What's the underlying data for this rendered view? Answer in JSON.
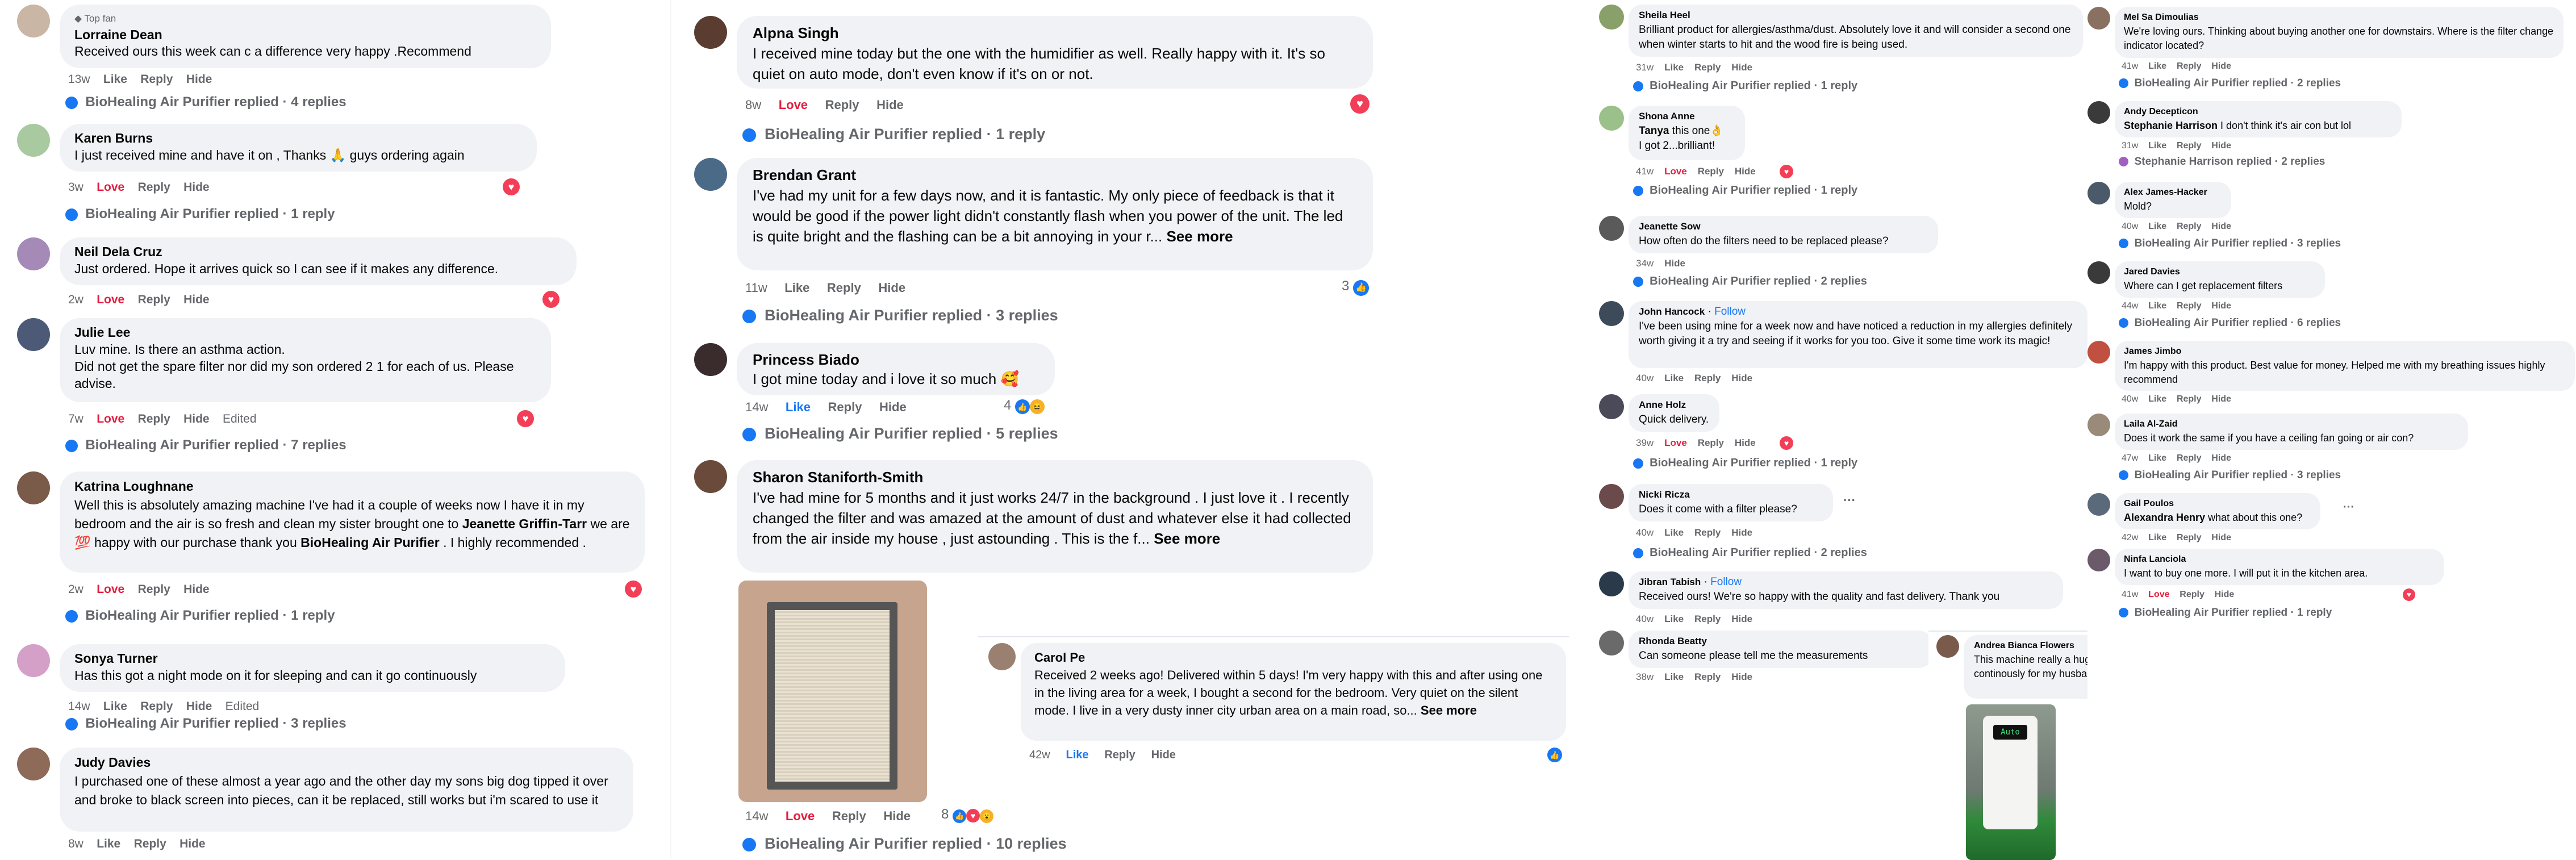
{
  "panel1": {
    "comments": [
      {
        "badge": "Top fan",
        "name": "Lorraine Dean",
        "text": "Received ours this week can c a difference very happy .Recommend",
        "time": "13w",
        "like": "Like",
        "reply": "Reply",
        "hide": "Hide",
        "replies": "BioHealing Air Purifier replied · 4 replies"
      },
      {
        "name": "Karen Burns",
        "text": "I just received mine and have it on , Thanks 🙏 guys ordering again",
        "time": "3w",
        "love": "Love",
        "reply": "Reply",
        "hide": "Hide",
        "replies": "BioHealing Air Purifier replied · 1 reply"
      },
      {
        "name": "Neil Dela Cruz",
        "text": "Just ordered. Hope it arrives quick so I can see if it makes any difference.",
        "time": "2w",
        "love": "Love",
        "reply": "Reply",
        "hide": "Hide"
      },
      {
        "name": "Julie Lee",
        "text": "Luv mine. Is there an asthma action.",
        "text2": "Did not get the spare filter nor did my son ordered 2 1 for each of us. Please advise.",
        "time": "7w",
        "love": "Love",
        "reply": "Reply",
        "hide": "Hide",
        "edited": "Edited",
        "replies": "BioHealing Air Purifier replied · 7 replies"
      },
      {
        "name": "Katrina Loughnane",
        "text_a": "Well this is absolutely amazing machine I've had it a couple of weeks now I have it in my bedroom and the air is so fresh and clean my sister brought one to ",
        "mention1": "Jeanette Griffin-Tarr",
        "text_b": " we are 💯 happy with our purchase thank you ",
        "mention2": "BioHealing Air Purifier",
        "text_c": " . I highly recommended .",
        "time": "2w",
        "love": "Love",
        "reply": "Reply",
        "hide": "Hide",
        "replies": "BioHealing Air Purifier replied · 1 reply"
      },
      {
        "name": "Sonya Turner",
        "text": "Has this got a night mode on it for sleeping and can it go continuously",
        "time": "14w",
        "like": "Like",
        "reply": "Reply",
        "hide": "Hide",
        "edited": "Edited",
        "replies": "BioHealing Air Purifier replied · 3 replies"
      },
      {
        "name": "Judy Davies",
        "text": "I purchased one of these almost a year ago and the other day my sons big dog tipped it over and broke to black screen into pieces, can it be replaced, still works but i'm scared to use it",
        "time": "8w",
        "like": "Like",
        "reply": "Reply",
        "hide": "Hide"
      }
    ]
  },
  "panel2": {
    "comments": [
      {
        "name": "Alpna Singh",
        "text": "I received mine today but the one with the humidifier as well. Really happy with it. It's so quiet on auto mode, don't even know if it's on or not.",
        "time": "8w",
        "love": "Love",
        "reply": "Reply",
        "hide": "Hide",
        "replies": "BioHealing Air Purifier replied · 1 reply"
      },
      {
        "name": "Brendan Grant",
        "text": "I've had my unit for a few days now, and it is fantastic. My only piece of feedback is that it would be good if the power light didn't constantly flash when you power of the unit. The led is quite bright and the flashing can be a bit annoying in your r...",
        "see_more": "See more",
        "time": "11w",
        "like": "Like",
        "reply": "Reply",
        "hide": "Hide",
        "reaction_count": "3",
        "replies": "BioHealing Air Purifier replied · 3 replies"
      },
      {
        "name": "Princess Biado",
        "text": "I got mine today and i love it so much 🥰",
        "time": "14w",
        "like": "Like",
        "reply": "Reply",
        "hide": "Hide",
        "reaction_count": "4",
        "replies": "BioHealing Air Purifier replied · 5 replies"
      },
      {
        "name": "Sharon Staniforth-Smith",
        "text": "I've had mine for 5 months and it just works 24/7 in the background . I just love it . I recently changed the filter and was amazed at the amount of dust and whatever else it had collected from the air inside my house , just astounding . This is the f...",
        "see_more": "See more",
        "time": "14w",
        "love": "Love",
        "reply": "Reply",
        "hide": "Hide",
        "reaction_count": "8",
        "replies": "BioHealing Air Purifier replied · 10 replies"
      },
      {
        "name": "Carol Pe",
        "text": "Received 2 weeks ago! Delivered within 5 days! I'm very happy with this and after using one in the living area for a week, I bought a second for the bedroom. Very quiet on the silent mode. I live in a very dusty inner city urban area on a main road, so...",
        "see_more": "See more",
        "time": "42w",
        "like": "Like",
        "reply": "Reply",
        "hide": "Hide"
      }
    ]
  },
  "panel3": {
    "comments": [
      {
        "name": "Sheila Heel",
        "text": "Brilliant product for allergies/asthma/dust. Absolutely love it and will consider a second one when winter starts to hit and the wood fire is being used.",
        "time": "31w",
        "like": "Like",
        "reply": "Reply",
        "hide": "Hide",
        "replies": "BioHealing Air Purifier replied · 1 reply"
      },
      {
        "name": "Shona Anne",
        "mention": "Tanya",
        "text": " this one👌",
        "text2": "I got 2...brilliant!",
        "time": "41w",
        "love": "Love",
        "reply": "Reply",
        "hide": "Hide",
        "replies": "BioHealing Air Purifier replied · 1 reply"
      },
      {
        "name": "Jeanette Sow",
        "text": "How often do the filters need to be replaced please?",
        "time": "34w",
        "hide": "Hide",
        "replies": "BioHealing Air Purifier replied · 2 replies"
      },
      {
        "name": "John Hancock",
        "follow": "Follow",
        "text": "I've been using mine for a week now and have noticed a reduction in my allergies definitely worth giving it a try and seeing if it works for you too. Give it some time work its magic!",
        "time": "40w",
        "like": "Like",
        "reply": "Reply",
        "hide": "Hide"
      },
      {
        "name": "Anne Holz",
        "text": "Quick delivery.",
        "time": "39w",
        "love": "Love",
        "reply": "Reply",
        "hide": "Hide",
        "replies": "BioHealing Air Purifier replied · 1 reply"
      },
      {
        "name": "Nicki Ricza",
        "text": "Does it come with a filter please?",
        "time": "40w",
        "like": "Like",
        "reply": "Reply",
        "hide": "Hide",
        "replies": "BioHealing Air Purifier replied · 2 replies"
      },
      {
        "name": "Jibran Tabish",
        "follow": "Follow",
        "text": "Received ours! We're so happy with the quality and fast delivery. Thank you",
        "time": "40w",
        "like": "Like",
        "reply": "Reply",
        "hide": "Hide"
      },
      {
        "name": "Rhonda Beatty",
        "text": "Can someone please tell me the measurements",
        "time": "38w",
        "like": "Like",
        "reply": "Reply",
        "hide": "Hide"
      },
      {
        "name": "Andrea Bianca Flowers",
        "text": "This machine really a huge help on breathing a cleaner air around our granny flat. It is on 24hrs continously for my husband who has problem on sniffing and cough all year round.",
        "screen": "Auto"
      }
    ]
  },
  "panel4": {
    "comments": [
      {
        "name": "Mel Sa Dimoulias",
        "text": "We're loving ours. Thinking about buying another one for downstairs. Where is the filter change indicator located?",
        "time": "41w",
        "like": "Like",
        "reply": "Reply",
        "hide": "Hide",
        "replies": "BioHealing Air Purifier replied · 2 replies"
      },
      {
        "name": "Andy Decepticon",
        "mention": "Stephanie Harrison",
        "text": " I don't think it's air con but lol",
        "time": "31w",
        "like": "Like",
        "reply": "Reply",
        "hide": "Hide",
        "replies": "Stephanie Harrison replied · 2 replies"
      },
      {
        "name": "Alex James-Hacker",
        "text": "Mold?",
        "time": "40w",
        "like": "Like",
        "reply": "Reply",
        "hide": "Hide",
        "replies": "BioHealing Air Purifier replied · 3 replies"
      },
      {
        "name": "Jared Davies",
        "text": "Where can I get replacement filters",
        "time": "44w",
        "like": "Like",
        "reply": "Reply",
        "hide": "Hide",
        "replies": "BioHealing Air Purifier replied · 6 replies"
      },
      {
        "name": "James Jimbo",
        "text": "I'm happy with this product. Best value for money. Helped me with my breathing issues highly recommend",
        "time": "40w",
        "like": "Like",
        "reply": "Reply",
        "hide": "Hide"
      },
      {
        "name": "Laila Al-Zaid",
        "text": "Does it work the same if you have a ceiling fan going or air con?",
        "time": "47w",
        "like": "Like",
        "reply": "Reply",
        "hide": "Hide",
        "replies": "BioHealing Air Purifier replied · 3 replies"
      },
      {
        "name": "Gail Poulos",
        "mention": "Alexandra Henry",
        "text": " what about this one?",
        "time": "42w",
        "like": "Like",
        "reply": "Reply",
        "hide": "Hide"
      },
      {
        "name": "Ninfa Lanciola",
        "text": "I want to buy one more. I will put it in the kitchen area.",
        "time": "41w",
        "love": "Love",
        "reply": "Reply",
        "hide": "Hide",
        "replies": "BioHealing Air Purifier replied · 1 reply"
      }
    ]
  },
  "colors": {
    "accent": "#1877f2",
    "love": "#e41e3f",
    "bubble": "#f0f2f5",
    "meta": "#65676b"
  }
}
